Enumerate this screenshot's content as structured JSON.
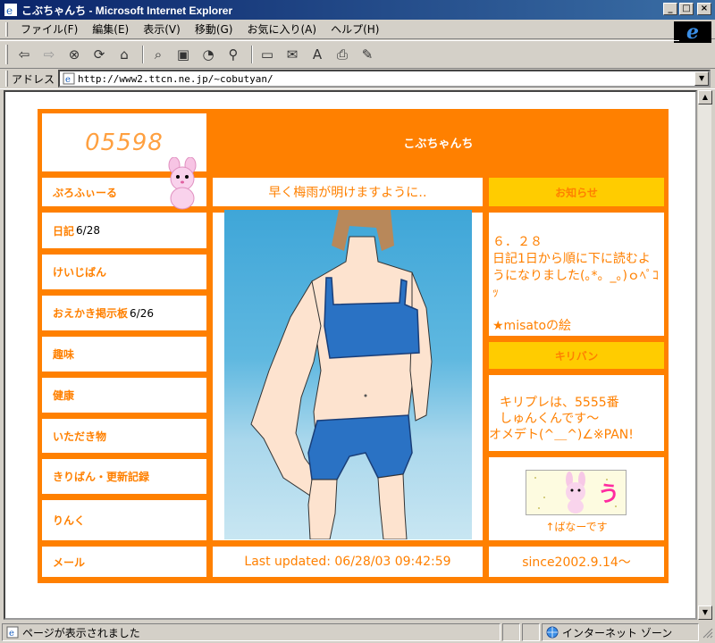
{
  "window": {
    "title": "こぶちゃんち - Microsoft Internet Explorer",
    "min": "_",
    "max": "□",
    "close": "×"
  },
  "menu": [
    "ファイル(F)",
    "編集(E)",
    "表示(V)",
    "移動(G)",
    "お気に入り(A)",
    "ヘルプ(H)"
  ],
  "toolbar_icons": [
    "back-icon",
    "forward-icon",
    "stop-icon",
    "refresh-icon",
    "home-icon",
    "search-icon",
    "favorites-icon",
    "history-icon",
    "channels-icon",
    "fullscreen-icon",
    "mail-icon",
    "font-icon",
    "print-icon",
    "edit-icon"
  ],
  "address": {
    "label": "アドレス",
    "url": "http://www2.ttcn.ne.jp/~cobutyan/"
  },
  "status": {
    "text": "ページが表示されました",
    "zone": "インターネット ゾーン"
  },
  "site": {
    "counter": "05598",
    "header": "こぶちゃんち",
    "banner": "早く梅雨が明けますように‥",
    "nav": [
      {
        "label": "ぷろふぃーる",
        "date": ""
      },
      {
        "label": "日記",
        "date": "6/28"
      },
      {
        "label": "けいじばん",
        "date": ""
      },
      {
        "label": "おえかき掲示板",
        "date": " 6/26"
      },
      {
        "label": "趣味",
        "date": ""
      },
      {
        "label": "健康",
        "date": ""
      },
      {
        "label": "いただき物",
        "date": ""
      },
      {
        "label": "きりばん・更新記録",
        "date": ""
      },
      {
        "label": "りんく",
        "date": ""
      },
      {
        "label": "メール",
        "date": ""
      }
    ],
    "notice_title": "お知らせ",
    "notice_date": "６．２８",
    "notice_text": "日記1日から順に下に読むようになりました(｡*。_｡)ｏﾍﾟｺｯ",
    "notice_link": "★misatoの絵",
    "kiriban_title": "キリバン",
    "kiriban_line1": "キリプレは、5555番",
    "kiriban_line2": "しゅんくんです～",
    "kiriban_line3": "オメデト(^＿^)∠※PAN!",
    "banner_caption": "↑ばなーです",
    "last_updated": "Last updated: 06/28/03 09:42:59",
    "since": "since2002.9.14～"
  },
  "colors": {
    "orange": "#ff8000",
    "yellow": "#ffcc00"
  }
}
